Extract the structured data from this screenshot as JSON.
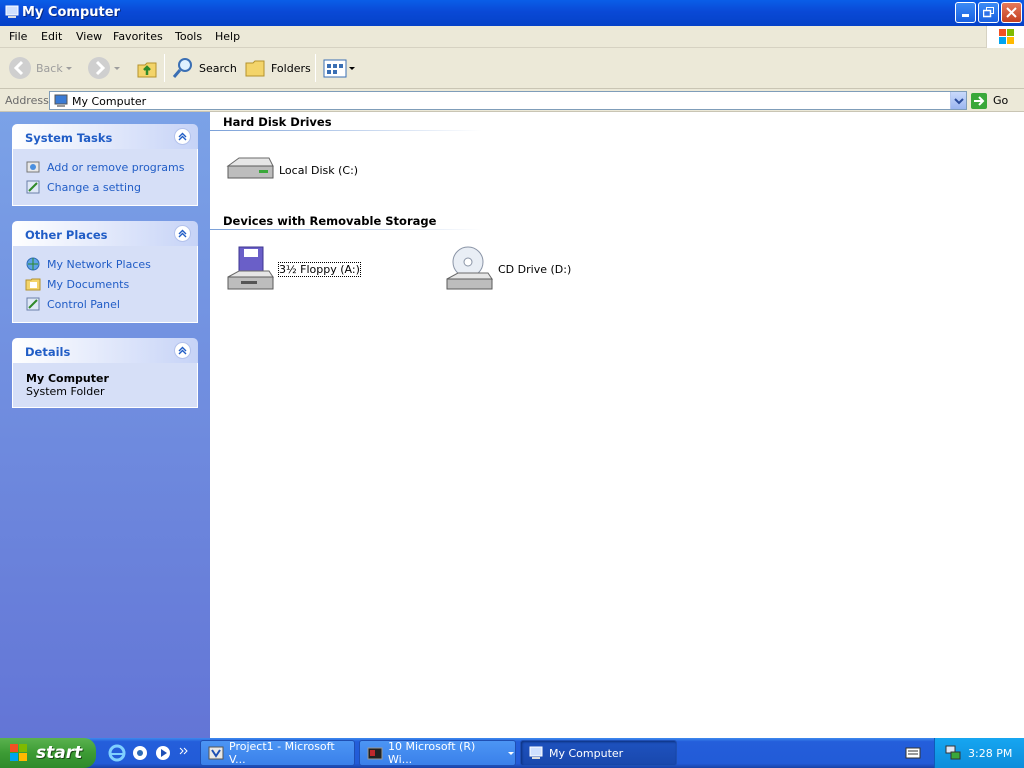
{
  "window": {
    "title": "My Computer"
  },
  "menu": [
    "File",
    "Edit",
    "View",
    "Favorites",
    "Tools",
    "Help"
  ],
  "toolbar": {
    "back": "Back",
    "search": "Search",
    "folders": "Folders"
  },
  "address": {
    "label": "Address",
    "value": "My Computer",
    "go": "Go"
  },
  "left_pane": {
    "system_tasks": {
      "title": "System Tasks",
      "items": [
        "Add or remove programs",
        "Change a setting"
      ]
    },
    "other_places": {
      "title": "Other Places",
      "items": [
        "My Network Places",
        "My Documents",
        "Control Panel"
      ]
    },
    "details": {
      "title": "Details",
      "name": "My Computer",
      "type": "System Folder"
    }
  },
  "content": {
    "groups": [
      {
        "title": "Hard Disk Drives",
        "items": [
          "Local Disk (C:)"
        ]
      },
      {
        "title": "Devices with Removable Storage",
        "items": [
          "3½ Floppy (A:)",
          "CD Drive (D:)"
        ]
      }
    ]
  },
  "taskbar": {
    "start": "start",
    "tasks": [
      "Project1 - Microsoft V...",
      "10 Microsoft (R) Wi...",
      "My Computer"
    ],
    "clock": "3:28 PM"
  },
  "colors": {
    "titlebar": "#0a49d6",
    "link": "#215dc6",
    "taskbar": "#245edb",
    "start": "#3c9b34"
  }
}
